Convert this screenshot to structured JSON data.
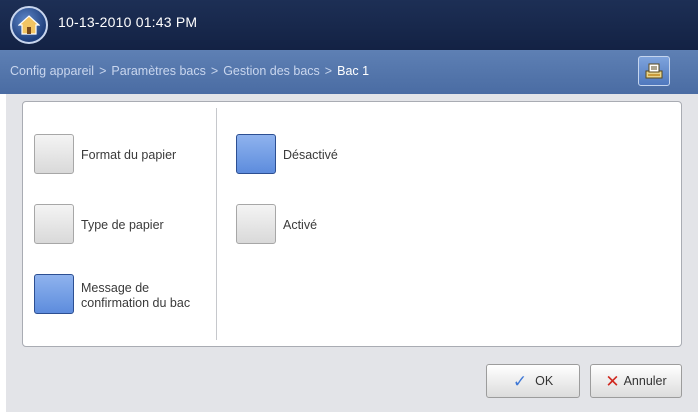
{
  "status_bar": {
    "datetime": "10-13-2010 01:43 PM",
    "home_icon": "home-icon"
  },
  "breadcrumb": {
    "items": [
      "Config appareil",
      "Paramètres bacs",
      "Gestion des bacs"
    ],
    "separator": ">",
    "current": "Bac 1",
    "action_icon": "tray-icon"
  },
  "menu": {
    "items": [
      {
        "label": "Format du papier",
        "selected": false
      },
      {
        "label": "Type de papier",
        "selected": false
      },
      {
        "label_line1": "Message de",
        "label_line2": "confirmation du bac",
        "selected": true
      }
    ]
  },
  "options": {
    "items": [
      {
        "label": "Désactivé",
        "selected": true
      },
      {
        "label": "Activé",
        "selected": false
      }
    ]
  },
  "footer": {
    "ok_label": "OK",
    "cancel_label": "Annuler",
    "ok_icon": "check-icon",
    "cancel_icon": "x-icon"
  },
  "colors": {
    "selected": "#5d8cdd",
    "topbar": "#132244",
    "crumbbar": "#4a6ca3",
    "ok_check": "#3f78d6",
    "cancel_x": "#d0281f"
  }
}
